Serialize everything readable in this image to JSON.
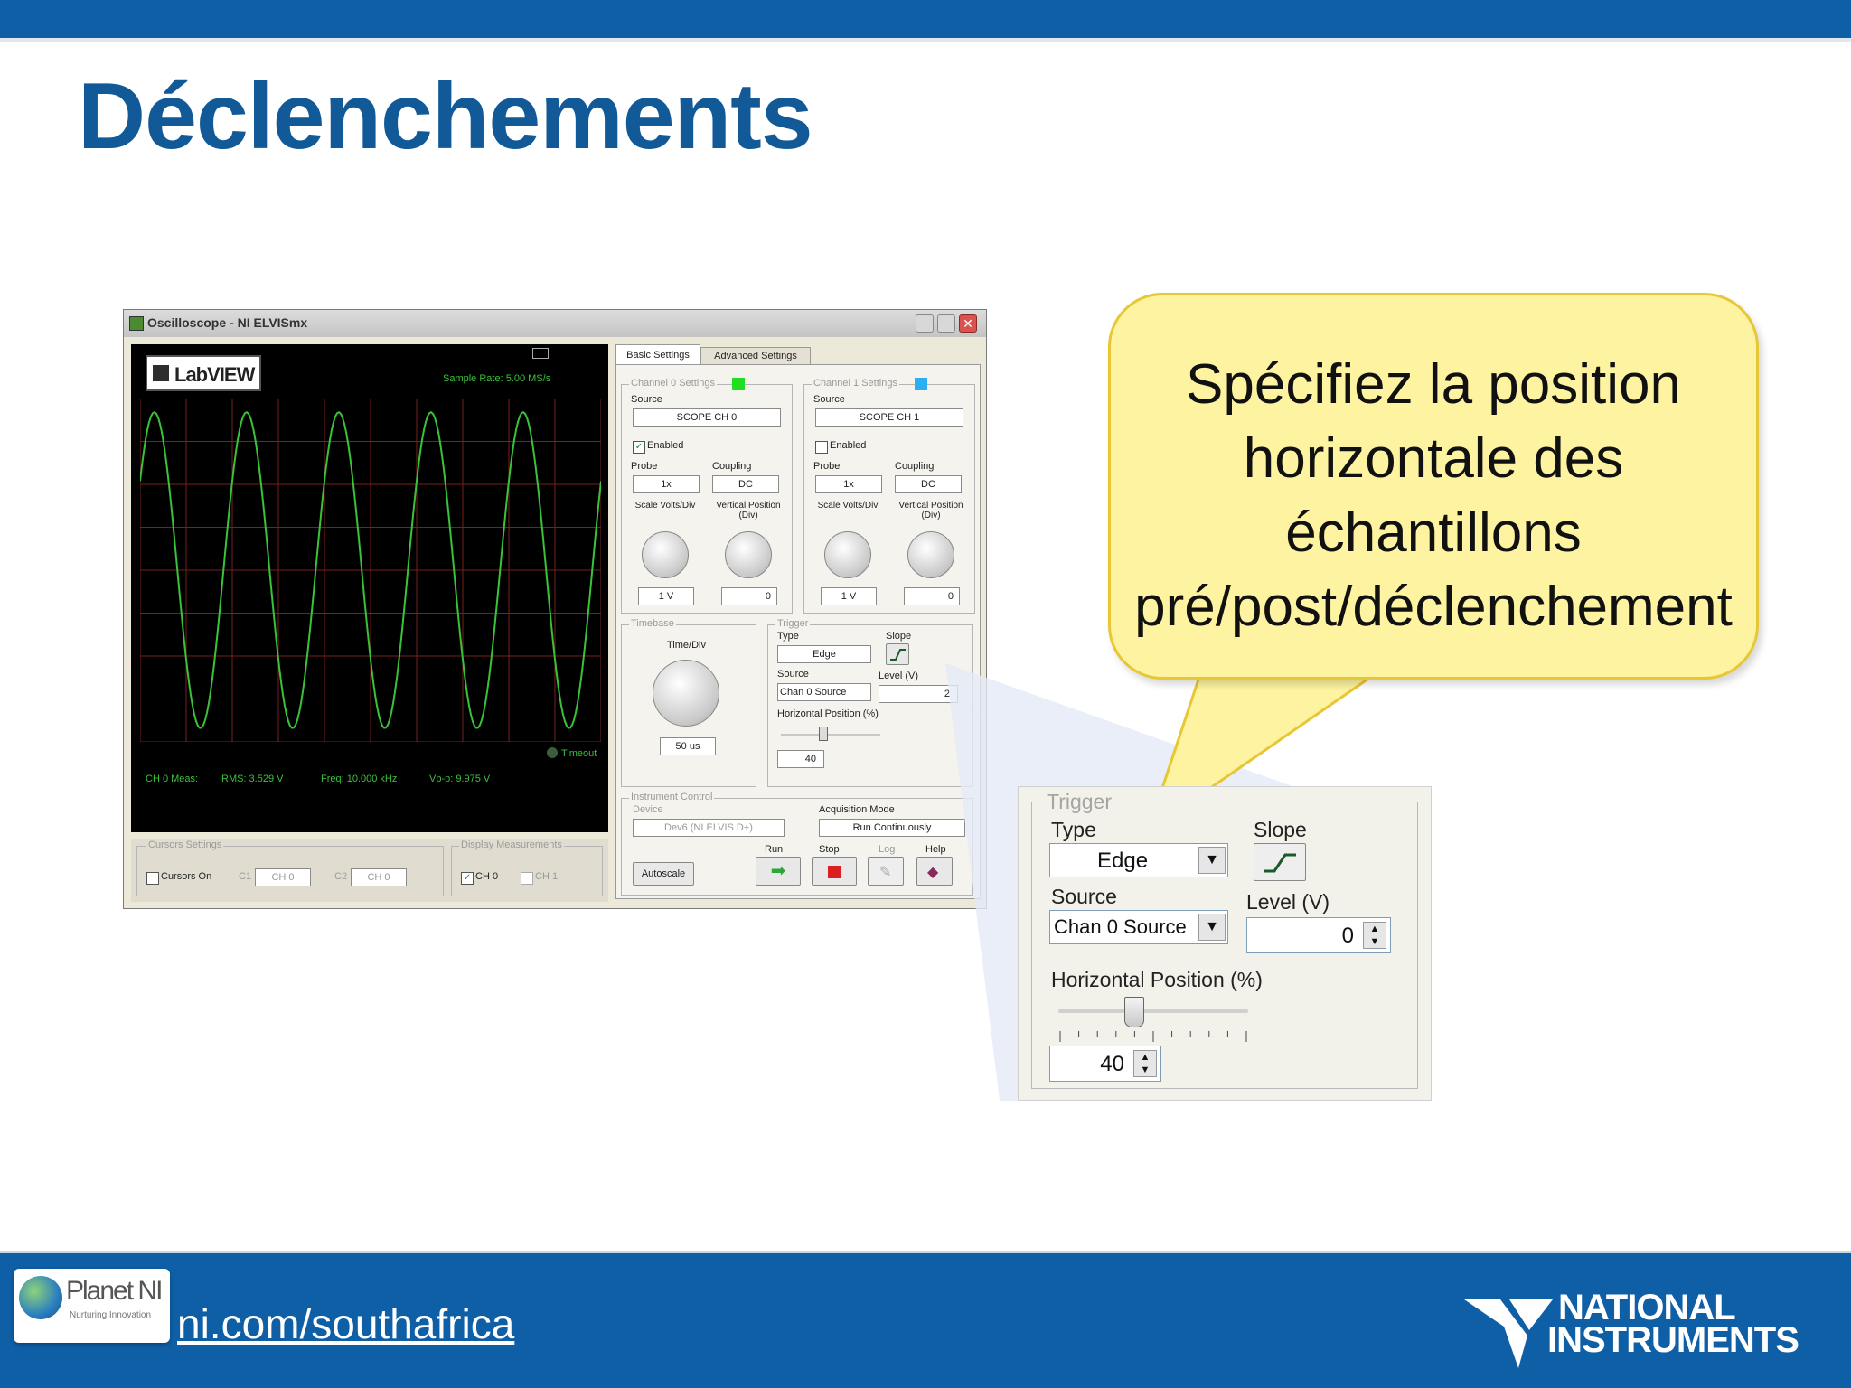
{
  "slide": {
    "title": "Déclenchements",
    "footer_url": "ni.com/southafrica",
    "planet_ni": {
      "name": "Planet NI",
      "tagline": "Nurturing Innovation"
    },
    "ni_logo": {
      "line1": "NATIONAL",
      "line2": "INSTRUMENTS"
    },
    "colors": {
      "brand_blue": "#0e5fa6",
      "title_blue": "#125a97",
      "callout_fill": "#fdf3a0",
      "callout_border": "#e8c734",
      "trace_green": "#39c23a"
    }
  },
  "callout": {
    "lines": [
      "Spécifiez la position",
      "horizontale des",
      "échantillons",
      "pré/post/déclenchement"
    ]
  },
  "scope_window": {
    "title": "Oscilloscope - NI ELVISmx",
    "logo": "LabVIEW",
    "sample_rate": "Sample Rate:  5.00 MS/s",
    "timeout": "Timeout",
    "measurements": {
      "label": "CH 0 Meas:",
      "rms": "RMS: 3.529 V",
      "freq": "Freq: 10.000 kHz",
      "vpp": "Vp-p: 9.975 V"
    },
    "cursors": {
      "group": "Cursors Settings",
      "cursors_on": "Cursors On",
      "c1": "C1",
      "c1_value": "CH 0",
      "c2": "C2",
      "c2_value": "CH 0"
    },
    "display": {
      "group": "Display Measurements",
      "ch0": "CH 0",
      "ch1": "CH 1"
    },
    "tabs": [
      "Basic Settings",
      "Advanced Settings"
    ],
    "channel0": {
      "group": "Channel 0 Settings",
      "source_label": "Source",
      "source": "SCOPE CH 0",
      "enabled": "Enabled",
      "probe_label": "Probe",
      "probe": "1x",
      "coupling_label": "Coupling",
      "coupling": "DC",
      "scale_label": "Scale Volts/Div",
      "scale": "1 V",
      "vpos_label": "Vertical Position (Div)",
      "vpos": "0"
    },
    "channel1": {
      "group": "Channel 1 Settings",
      "source_label": "Source",
      "source": "SCOPE CH 1",
      "enabled": "Enabled",
      "probe_label": "Probe",
      "probe": "1x",
      "coupling_label": "Coupling",
      "coupling": "DC",
      "scale_label": "Scale Volts/Div",
      "scale": "1 V",
      "vpos_label": "Vertical Position (Div)",
      "vpos": "0"
    },
    "timebase": {
      "group": "Timebase",
      "label": "Time/Div",
      "value": "50 us"
    },
    "trigger": {
      "group": "Trigger",
      "type_label": "Type",
      "type": "Edge",
      "slope_label": "Slope",
      "source_label": "Source",
      "source": "Chan 0 Source",
      "level_label": "Level (V)",
      "level": "2",
      "hpos_label": "Horizontal Position (%)",
      "hpos": "40"
    },
    "instrument": {
      "group": "Instrument Control",
      "device_label": "Device",
      "device": "Dev6 (NI ELVIS D+)",
      "acq_label": "Acquisition Mode",
      "acq": "Run Continuously",
      "autoscale": "Autoscale",
      "run": "Run",
      "stop": "Stop",
      "log": "Log",
      "help": "Help"
    }
  },
  "zoom_trigger": {
    "group": "Trigger",
    "type_label": "Type",
    "type": "Edge",
    "slope_label": "Slope",
    "source_label": "Source",
    "source": "Chan 0 Source",
    "level_label": "Level (V)",
    "level": "0",
    "hpos_label": "Horizontal Position (%)",
    "hpos": "40",
    "hpos_fraction": 0.4
  }
}
